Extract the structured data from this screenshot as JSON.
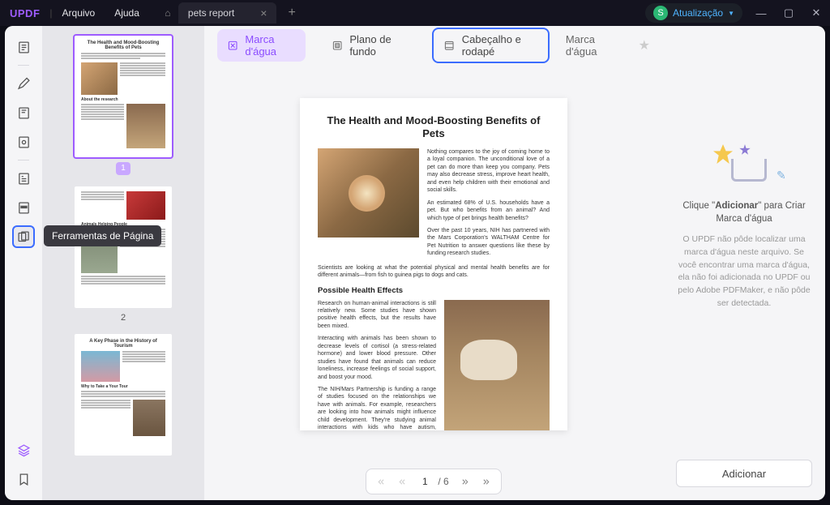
{
  "titlebar": {
    "logo": "UPDF",
    "menu": {
      "file": "Arquivo",
      "help": "Ajuda"
    },
    "tab_name": "pets report",
    "user_initial": "S",
    "upgrade": "Atualização"
  },
  "rail": {
    "tooltip": "Ferramentas de Página"
  },
  "thumbs": {
    "page1_badge": "1",
    "page2_num": "2",
    "t1_title": "The Health and Mood-Boosting Benefits of Pets",
    "t3_title": "A Key Phase in the History of Tourism"
  },
  "toolbar": {
    "watermark": "Marca d'água",
    "background": "Plano de fundo",
    "headerfooter": "Cabeçalho e rodapé",
    "panel_title": "Marca d'água"
  },
  "document": {
    "title": "The Health and Mood-Boosting Benefits of Pets",
    "p1": "Nothing compares to the joy of coming home to a loyal companion. The unconditional love of a pet can do more than keep you company. Pets may also decrease stress, improve heart health, and even help children with their emotional and social skills.",
    "p2": "An estimated 68% of U.S. households have a pet. But who benefits from an animal? And which type of pet brings health benefits?",
    "p3": "Over the past 10 years, NIH has partnered with the Mars Corporation's WALTHAM Centre for Pet Nutrition to answer questions like these by funding research studies.",
    "p4": "Scientists are looking at what the potential physical and mental health benefits are for different animals—from fish to guinea pigs to dogs and cats.",
    "h2": "Possible Health Effects",
    "p5": "Research on human-animal interactions is still relatively new. Some studies have shown positive health effects, but the results have been mixed.",
    "p6": "Interacting with animals has been shown to decrease levels of cortisol (a stress-related hormone) and lower blood pressure. Other studies have found that animals can reduce loneliness, increase feelings of social support, and boost your mood.",
    "p7": "The NIH/Mars Partnership is funding a range of studies focused on the relationships we have with animals. For example, researchers are looking into how animals might influence child development. They're studying animal interactions with kids who have autism, attention deficit hyperactivity disorder (ADHD), and other conditions."
  },
  "pager": {
    "current": "1",
    "total": "/ 6"
  },
  "rpanel": {
    "title_pre": "Clique \"",
    "title_bold": "Adicionar",
    "title_post": "\" para Criar Marca d'água",
    "desc": "O UPDF não pôde localizar uma marca d'água neste arquivo. Se você encontrar uma marca d'água, ela não foi adicionada no UPDF ou pelo Adobe PDFMaker, e não pôde ser detectada.",
    "add_btn": "Adicionar"
  }
}
